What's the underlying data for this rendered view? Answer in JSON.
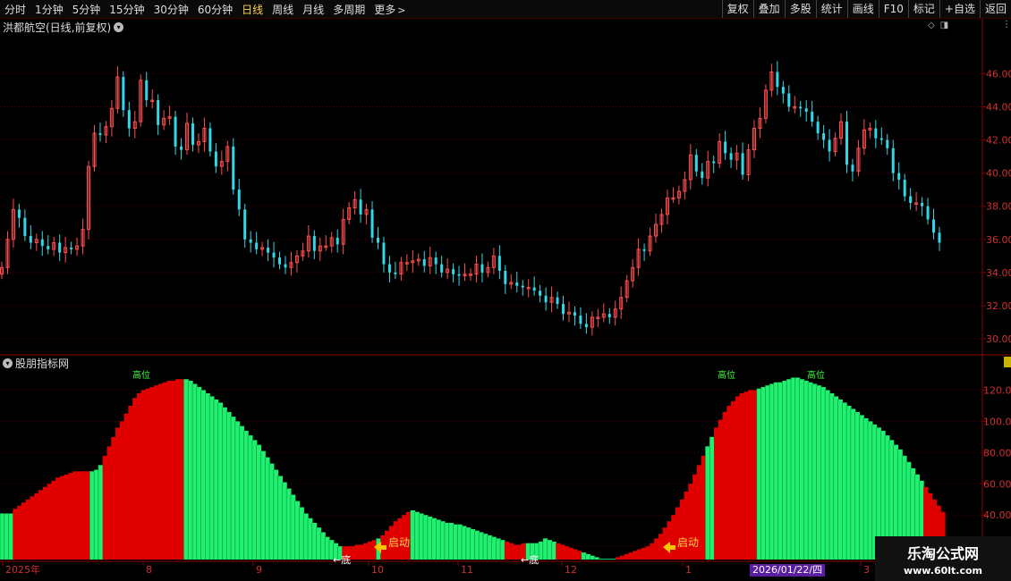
{
  "toolbar": {
    "periods": [
      "分时",
      "1分钟",
      "5分钟",
      "15分钟",
      "30分钟",
      "60分钟",
      "日线",
      "周线",
      "月线",
      "多周期",
      "更多"
    ],
    "active_period": "日线",
    "right_buttons": [
      "复权",
      "叠加",
      "多股",
      "统计",
      "画线",
      "F10",
      "标记",
      "+自选",
      "返回"
    ]
  },
  "main_panel": {
    "title": "洪都航空(日线,前复权)"
  },
  "indicator_panel": {
    "title": "股朋指标网"
  },
  "annotations": {
    "high": "高位",
    "bottom": "←底",
    "start": "启动"
  },
  "xaxis_labels": [
    "2025年",
    "8",
    "9",
    "10",
    "11",
    "12",
    "1",
    "2026/01/22/四",
    "3"
  ],
  "watermark": {
    "title": "乐淘公式网",
    "url": "www.60lt.com"
  },
  "colors": {
    "up": "#ff4d4d",
    "down": "#32d8e8",
    "red_fill": "#e00000",
    "green_fill": "#1ff070",
    "axis": "#8a0000"
  },
  "chart_data": [
    {
      "type": "candlestick",
      "title": "洪都航空(日线,前复权)",
      "yticks": [
        30.0,
        32.0,
        34.0,
        36.0,
        38.0,
        40.0,
        42.0,
        44.0,
        46.0
      ],
      "ylim": [
        29.3,
        48.5
      ],
      "close": [
        34.3,
        36.0,
        37.8,
        37.3,
        36.2,
        35.8,
        36.0,
        35.6,
        35.4,
        35.8,
        35.2,
        35.5,
        35.4,
        35.6,
        36.6,
        40.4,
        42.4,
        42.3,
        42.8,
        43.9,
        45.8,
        43.8,
        42.7,
        43.1,
        45.6,
        44.4,
        44.4,
        42.9,
        43.3,
        43.4,
        41.6,
        41.4,
        43.0,
        41.7,
        41.9,
        42.7,
        41.3,
        40.4,
        40.7,
        41.6,
        39.0,
        37.8,
        36.0,
        35.8,
        35.4,
        35.5,
        35.2,
        34.9,
        34.5,
        34.3,
        34.6,
        35.0,
        35.3,
        36.2,
        35.3,
        35.6,
        35.6,
        36.1,
        35.7,
        37.2,
        37.9,
        38.4,
        37.5,
        37.8,
        36.1,
        35.8,
        34.5,
        34.0,
        33.9,
        34.6,
        34.6,
        34.7,
        34.8,
        34.4,
        34.9,
        34.5,
        34.0,
        34.2,
        33.9,
        33.8,
        33.9,
        33.9,
        34.5,
        34.0,
        34.3,
        35.0,
        34.1,
        33.3,
        33.4,
        33.2,
        33.1,
        33.1,
        32.9,
        32.6,
        32.2,
        32.5,
        32.1,
        31.5,
        31.6,
        31.4,
        30.9,
        30.7,
        31.3,
        31.3,
        31.5,
        31.3,
        31.8,
        32.5,
        33.5,
        34.3,
        35.4,
        35.3,
        36.2,
        36.9,
        37.5,
        38.5,
        38.5,
        38.9,
        39.6,
        41.1,
        40.1,
        39.7,
        40.7,
        40.6,
        41.9,
        41.2,
        40.8,
        41.2,
        39.9,
        41.4,
        42.7,
        43.3,
        45.0,
        46.1,
        45.2,
        44.8,
        44.0,
        44.0,
        43.9,
        43.7,
        43.1,
        42.4,
        42.0,
        41.3,
        42.1,
        43.1,
        40.5,
        40.1,
        41.5,
        42.6,
        42.7,
        42.1,
        42.0,
        41.5,
        40.0,
        39.6,
        38.6,
        38.2,
        38.2,
        38.0,
        37.2,
        36.4,
        35.8
      ]
    },
    {
      "type": "area",
      "yticks": [
        20.0,
        40.0,
        60.0,
        80.0,
        100.0,
        120.0
      ],
      "ylim": [
        11.5,
        134
      ],
      "values": [
        41,
        41,
        41,
        44,
        46,
        48,
        50,
        52,
        54,
        56,
        58,
        60,
        62,
        64,
        65,
        66,
        67,
        68,
        68,
        68,
        68,
        68,
        69,
        72,
        78,
        84,
        90,
        96,
        100,
        105,
        110,
        115,
        118,
        120,
        121,
        122,
        123,
        124,
        125,
        126,
        126,
        127,
        127,
        127,
        126,
        124,
        122,
        120,
        118,
        116,
        114,
        112,
        109,
        106,
        103,
        100,
        97,
        94,
        91,
        88,
        85,
        81,
        77,
        73,
        69,
        65,
        61,
        57,
        53,
        49,
        45,
        41,
        38,
        35,
        32,
        29,
        26,
        24,
        22,
        20,
        20,
        20,
        20,
        21,
        21,
        22,
        23,
        24,
        25,
        27,
        30,
        33,
        36,
        38,
        40,
        42,
        43,
        42,
        41,
        40,
        39,
        38,
        37,
        36,
        35,
        35,
        34,
        34,
        33,
        32,
        31,
        30,
        29,
        28,
        27,
        26,
        25,
        24,
        23,
        22,
        21,
        21,
        22,
        22,
        22,
        22,
        23,
        25,
        24,
        23,
        22,
        21,
        20,
        19,
        18,
        17,
        16,
        15,
        14,
        13,
        12,
        12,
        12,
        12,
        13,
        14,
        15,
        16,
        17,
        18,
        19,
        20,
        22,
        25,
        28,
        32,
        36,
        40,
        45,
        50,
        55,
        60,
        66,
        72,
        78,
        84,
        90,
        96,
        101,
        106,
        110,
        113,
        116,
        118,
        119,
        120,
        120,
        121,
        122,
        123,
        124,
        125,
        125,
        126,
        127,
        128,
        128,
        127,
        126,
        125,
        124,
        123,
        122,
        120,
        118,
        116,
        114,
        112,
        110,
        108,
        106,
        104,
        102,
        100,
        98,
        96,
        94,
        91,
        88,
        85,
        82,
        78,
        74,
        70,
        66,
        62,
        58,
        54,
        50,
        46,
        42
      ],
      "green_ranges": [
        [
          0,
          2
        ],
        [
          21,
          23
        ],
        [
          43,
          79
        ],
        [
          88,
          88
        ],
        [
          96,
          117
        ],
        [
          123,
          129
        ],
        [
          136,
          143
        ],
        [
          165,
          166
        ],
        [
          177,
          215
        ]
      ]
    }
  ]
}
